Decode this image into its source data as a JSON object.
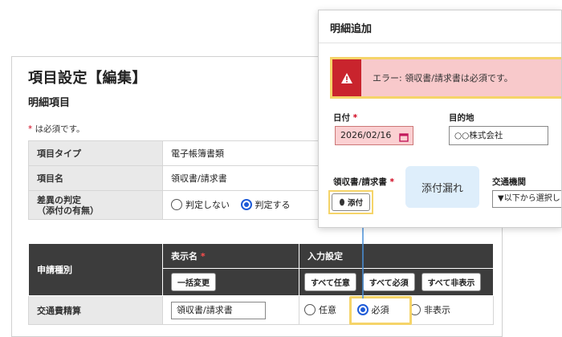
{
  "back": {
    "title": "項目設定【編集】",
    "subtitle": "明細項目",
    "required_star": "*",
    "required_note": " は必須です。",
    "rows": [
      {
        "label": "項目タイプ",
        "value": "電子帳簿書類"
      },
      {
        "label": "項目名",
        "value": "領収書/請求書"
      }
    ],
    "diff_label_line1": "差異の判定",
    "diff_label_line2": "（添付の有無）",
    "diff_options": [
      "判定しない",
      "判定する"
    ],
    "diff_selected": "判定する",
    "table": {
      "app_type_header": "申請種別",
      "display_name_header": "表示名",
      "input_setting_header": "入力設定",
      "bulk_change_label": "一括変更",
      "all_optional_label": "すべて任意",
      "all_required_label": "すべて必須",
      "all_hidden_label": "すべて非表示",
      "row_label": "交通費精算",
      "row_input_value": "領収書/請求書",
      "options": [
        "任意",
        "必須",
        "非表示"
      ],
      "selected": "必須"
    }
  },
  "dialog": {
    "title": "明細追加",
    "error_message": "エラー: 領収書/請求書は必須です。",
    "date_label": "日付",
    "date_value": "2026/02/16",
    "destination_label": "目的地",
    "destination_value": "○○株式会社",
    "receipt_label": "領収書/請求書",
    "attach_label": "添付",
    "transport_label": "交通機関",
    "transport_value": "▼以下から選択し"
  },
  "annotation": {
    "tooltip": "添付漏れ"
  },
  "colors": {
    "highlight": "#f5d469",
    "error_bg": "#f8c9cb",
    "error_icon": "#c9242d",
    "dark_header": "#3c3c3c",
    "tooltip_bg": "#deeefb",
    "radio_on": "#1e5bd8",
    "connector": "#4a90d9"
  }
}
